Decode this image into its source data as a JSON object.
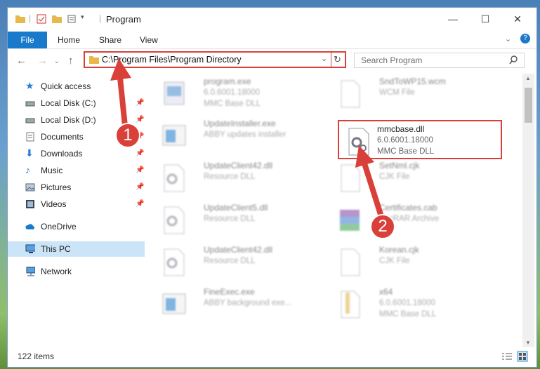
{
  "window": {
    "title": "Program"
  },
  "ribbon": {
    "file": "File",
    "home": "Home",
    "share": "Share",
    "view": "View"
  },
  "address": {
    "path": "C:\\Program Files\\Program Directory"
  },
  "search": {
    "placeholder": "Search Program"
  },
  "nav": {
    "items": [
      {
        "label": "Quick access"
      },
      {
        "label": "Local Disk (C:)"
      },
      {
        "label": "Local Disk (D:)"
      },
      {
        "label": "Documents"
      },
      {
        "label": "Downloads"
      },
      {
        "label": "Music"
      },
      {
        "label": "Pictures"
      },
      {
        "label": "Videos"
      },
      {
        "label": "OneDrive"
      },
      {
        "label": "This PC"
      },
      {
        "label": "Network"
      }
    ]
  },
  "files": [
    {
      "name": "program.exe",
      "line2": "6.0.6001.18000",
      "line3": "MMC Base DLL"
    },
    {
      "name": "SndToWP15.wcm",
      "line2": "WCM File",
      "line3": ""
    },
    {
      "name": "UpdateInstaller.exe",
      "line2": "ABBY updates installer",
      "line3": ""
    },
    {
      "name": "mmcbase.dll",
      "line2": "6.0.6001.18000",
      "line3": "MMC Base DLL"
    },
    {
      "name": "UpdateClient42.dll",
      "line2": "Resource DLL",
      "line3": ""
    },
    {
      "name": "SetNml.cjk",
      "line2": "CJK File",
      "line3": ""
    },
    {
      "name": "UpdateClient5.dll",
      "line2": "Resource DLL",
      "line3": ""
    },
    {
      "name": "Certificates.cab",
      "line2": "WinRAR Archive",
      "line3": ""
    },
    {
      "name": "UpdateClient42.dll",
      "line2": "Resource DLL",
      "line3": ""
    },
    {
      "name": "Korean.cjk",
      "line2": "CJK File",
      "line3": ""
    },
    {
      "name": "FineExec.exe",
      "line2": "ABBY background exe...",
      "line3": ""
    },
    {
      "name": "x64",
      "line2": "6.0.6001.18000",
      "line3": "MMC Base DLL"
    }
  ],
  "status": {
    "count": "122 items"
  },
  "callouts": {
    "one": "1",
    "two": "2"
  },
  "colors": {
    "accent": "#1979ca",
    "highlight": "#d9403a",
    "selected": "#cce4f7"
  }
}
